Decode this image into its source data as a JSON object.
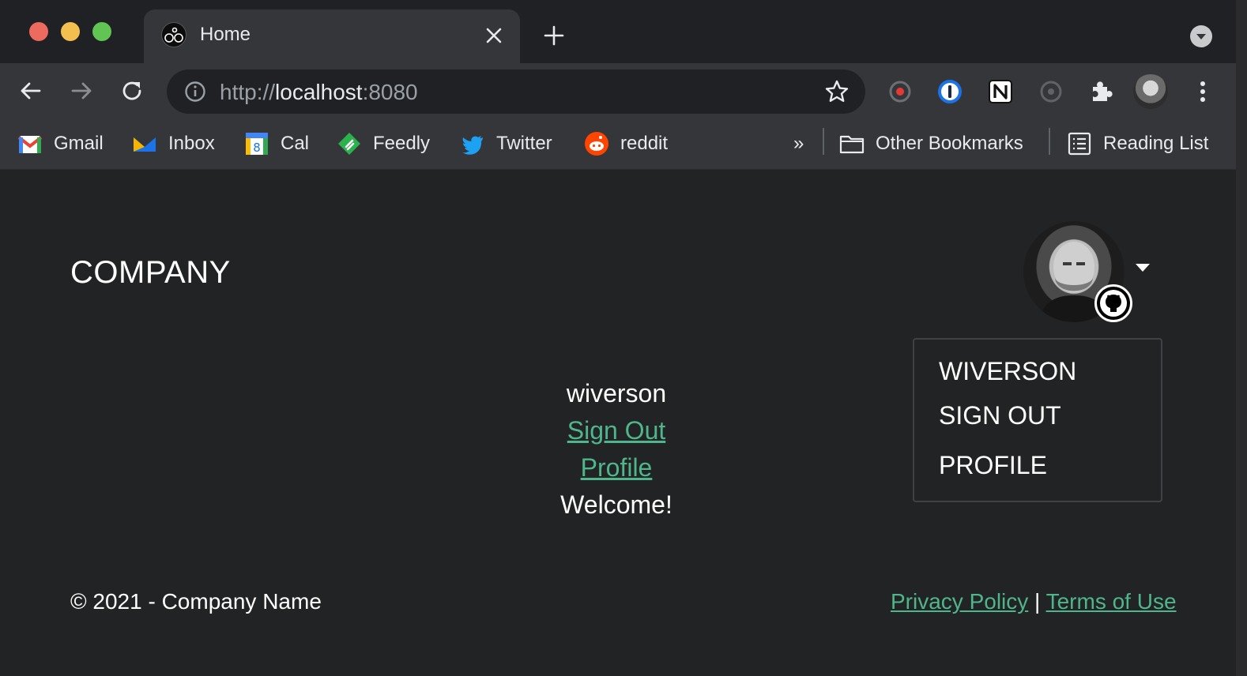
{
  "browser": {
    "tab": {
      "title": "Home",
      "favicon": "cyclist-logo-icon"
    },
    "address": {
      "scheme": "http://",
      "host": "localhost",
      "port": ":8080"
    },
    "bookmarks": [
      {
        "label": "Gmail",
        "icon": "gmail-icon"
      },
      {
        "label": "Inbox",
        "icon": "inbox-icon"
      },
      {
        "label": "Cal",
        "icon": "calendar-icon"
      },
      {
        "label": "Feedly",
        "icon": "feedly-icon"
      },
      {
        "label": "Twitter",
        "icon": "twitter-icon"
      },
      {
        "label": "reddit",
        "icon": "reddit-icon"
      }
    ],
    "overflow_label": "»",
    "other_bookmarks": "Other Bookmarks",
    "reading_list": "Reading List"
  },
  "page": {
    "brand": "COMPANY",
    "dropdown": {
      "username": "WIVERSON",
      "sign_out": "SIGN OUT",
      "profile": "PROFILE"
    },
    "main": {
      "username": "wiverson",
      "sign_out": "Sign Out",
      "profile": "Profile",
      "welcome": "Welcome!"
    },
    "footer": {
      "copyright": "© 2021 - Company Name",
      "privacy": "Privacy Policy",
      "separator": " | ",
      "terms": "Terms of Use"
    }
  },
  "colors": {
    "link": "#4fb58c",
    "page_bg": "#222324",
    "chrome_bg": "#35363a"
  }
}
